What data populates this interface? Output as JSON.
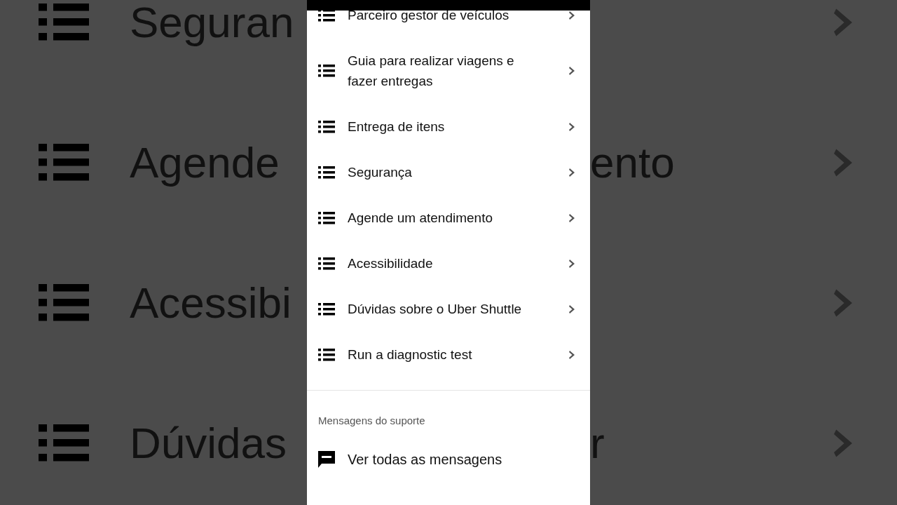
{
  "background": {
    "rows": [
      {
        "label": "Seguran"
      },
      {
        "label": "Agende",
        "tail": "ento"
      },
      {
        "label": "Acessibi"
      },
      {
        "label": "Dúvidas",
        "tail": "r"
      }
    ]
  },
  "help_list": {
    "items": [
      {
        "label": "Parceiro gestor de veículos"
      },
      {
        "label": "Guia para realizar viagens e fazer entregas"
      },
      {
        "label": "Entrega de itens"
      },
      {
        "label": "Segurança"
      },
      {
        "label": "Agende um atendimento"
      },
      {
        "label": "Acessibilidade"
      },
      {
        "label": "Dúvidas sobre o Uber Shuttle"
      },
      {
        "label": "Run a diagnostic test"
      }
    ]
  },
  "support": {
    "heading": "Mensagens do suporte",
    "items": [
      {
        "label": "Ver todas as mensagens"
      }
    ]
  }
}
